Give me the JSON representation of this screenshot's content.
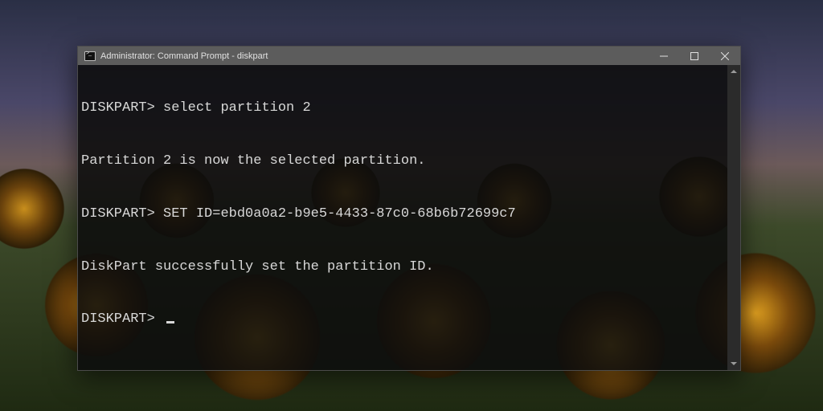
{
  "window": {
    "title": "Administrator: Command Prompt - diskpart"
  },
  "terminal": {
    "prompt": "DISKPART>",
    "lines": [
      {
        "prompt": "DISKPART>",
        "cmd": "select partition 2"
      },
      {
        "out": "Partition 2 is now the selected partition."
      },
      {
        "prompt": "DISKPART>",
        "cmd": "SET ID=ebd0a0a2-b9e5-4433-87c0-68b6b72699c7"
      },
      {
        "out": "DiskPart successfully set the partition ID."
      }
    ]
  }
}
